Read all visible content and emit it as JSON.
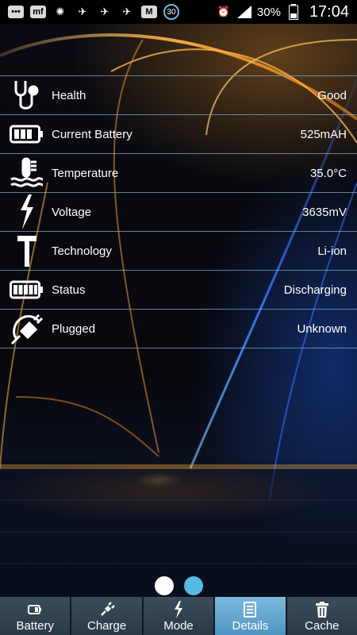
{
  "status_bar": {
    "notification_icons": [
      "chat-icon",
      "app-icon-mf",
      "sun-icon",
      "airplane-notif-icon",
      "airplane-notif-icon",
      "airplane-notif-icon",
      "mail-notif-icon"
    ],
    "mf_label": "mf",
    "m_label": "M",
    "calendar_badge": "30",
    "battery_percent": "30%",
    "time": "17:04"
  },
  "details": [
    {
      "icon": "stethoscope-icon",
      "label": "Health",
      "value": "Good"
    },
    {
      "icon": "battery-icon",
      "label": "Current Battery",
      "value": "525mAH"
    },
    {
      "icon": "thermometer-icon",
      "label": "Temperature",
      "value": "35.0°C"
    },
    {
      "icon": "lightning-icon",
      "label": "Voltage",
      "value": "3635mV"
    },
    {
      "icon": "hammer-icon",
      "label": "Technology",
      "value": "Li-ion"
    },
    {
      "icon": "battery-full-icon",
      "label": "Status",
      "value": "Discharging"
    },
    {
      "icon": "plug-icon",
      "label": "Plugged",
      "value": "Unknown"
    }
  ],
  "pager": {
    "pages": 2,
    "current": 1
  },
  "tabs": [
    {
      "label": "Battery",
      "icon": "battery-small-icon",
      "active": false
    },
    {
      "label": "Charge",
      "icon": "plug-small-icon",
      "active": false
    },
    {
      "label": "Mode",
      "icon": "lightning-small-icon",
      "active": false
    },
    {
      "label": "Details",
      "icon": "document-icon",
      "active": true
    },
    {
      "label": "Cache",
      "icon": "trash-icon",
      "active": false
    }
  ],
  "colors": {
    "accent": "#57b9e0",
    "active_tab": "#6aaad3",
    "divider": "#78aac8"
  }
}
